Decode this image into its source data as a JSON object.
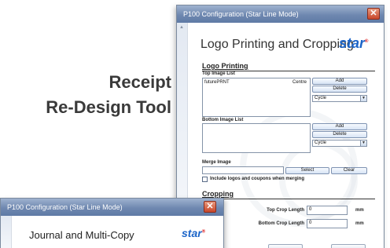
{
  "headline": {
    "line1": "Receipt",
    "line2": "Re-Design Tool"
  },
  "main_window": {
    "title": "P100 Configuration (Star Line Mode)",
    "close_icon": "close-icon",
    "heading": "Logo Printing and Cropping",
    "logo_text": "star",
    "logo_mark": "®",
    "logo_printing": {
      "section_title": "Logo Printing",
      "top_list_label": "Top Image List",
      "top_items": [
        {
          "name": "futurePRNT",
          "align": "Centre"
        }
      ],
      "add_label": "Add",
      "delete_label": "Delete",
      "cycle_label": "Cycle",
      "bottom_list_label": "Bottom Image List",
      "bottom_add_label": "Add",
      "bottom_delete_label": "Delete",
      "bottom_cycle_label": "Cycle"
    },
    "merge": {
      "label": "Merge Image",
      "value": "",
      "select_label": "Select",
      "clear_label": "Clear",
      "include_label": "Include logos and coupons when merging",
      "include_checked": false
    },
    "cropping": {
      "section_title": "Cropping",
      "top_label": "Top Crop Length",
      "top_value": "0",
      "top_unit": "mm",
      "bottom_label": "Bottom Crop Length",
      "bottom_value": "0",
      "bottom_unit": "mm"
    }
  },
  "second_window": {
    "title": "P100 Configuration (Star Line Mode)",
    "close_icon": "close-icon",
    "heading": "Journal and Multi-Copy",
    "logo_text": "star",
    "logo_mark": "®"
  },
  "colors": {
    "titlebar": "#6f88b0",
    "close_button": "#c8462a",
    "brand_blue": "#1b64c8",
    "headline_text": "#3a3a3a"
  }
}
